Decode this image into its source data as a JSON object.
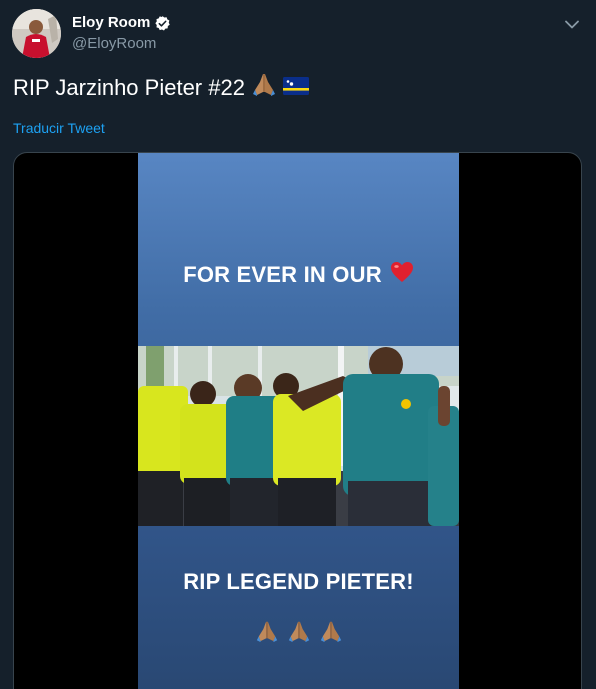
{
  "author": {
    "name": "Eloy Room",
    "handle": "@EloyRoom"
  },
  "tweet": {
    "text": "RIP Jarzinho Pieter #22",
    "translate_label": "Traducir Tweet"
  },
  "media": {
    "story_line_1": "FOR EVER IN OUR",
    "story_line_2": "RIP LEGEND PIETER!"
  },
  "icons": {
    "verified": "verified-badge-icon",
    "caret": "chevron-down-icon",
    "prayer": "folded-hands-emoji",
    "heart": "red-heart-emoji",
    "flag": "curacao-flag-emoji"
  },
  "colors": {
    "background": "#15202b",
    "link": "#1da1f2",
    "secondary_text": "#8899a6",
    "border": "#38444d",
    "story_blue": "#416da6"
  }
}
